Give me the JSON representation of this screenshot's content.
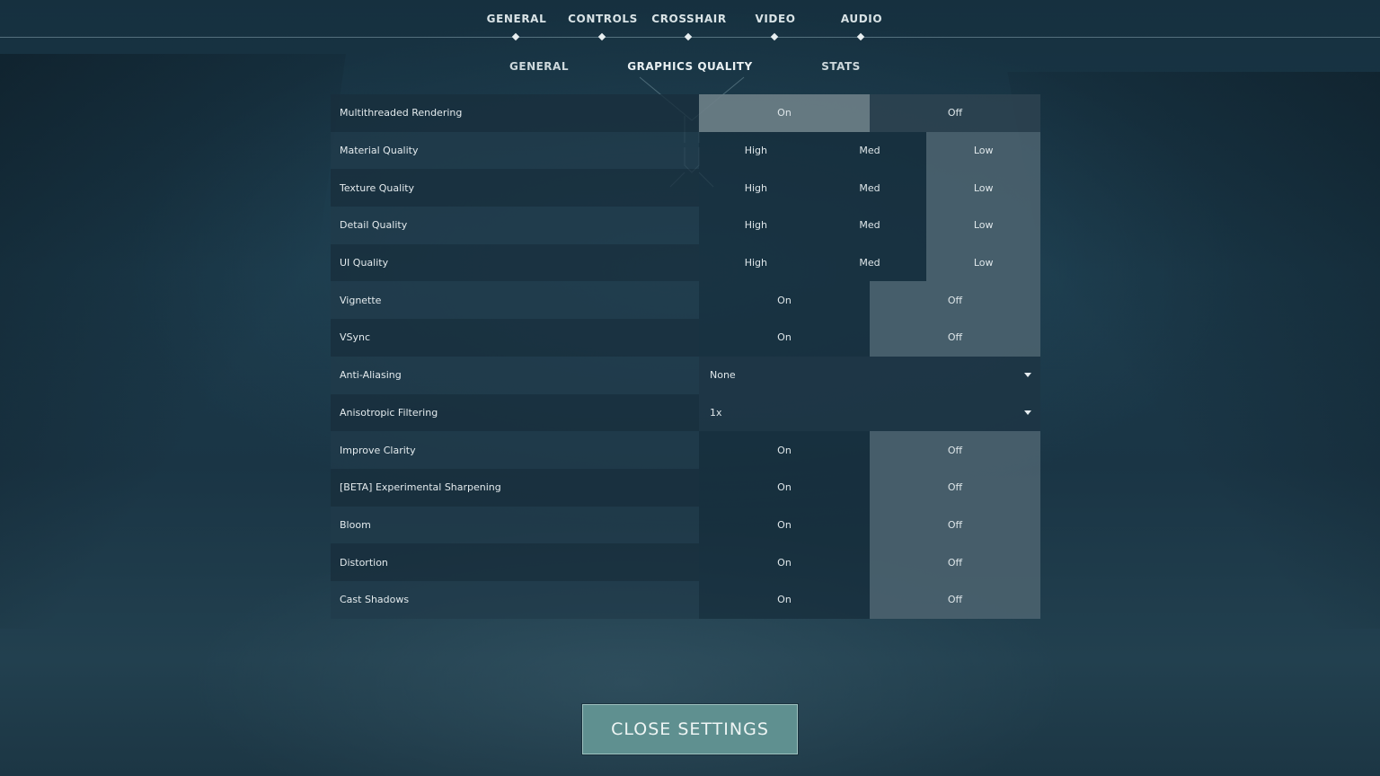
{
  "top_tabs": [
    {
      "label": "GENERAL"
    },
    {
      "label": "CONTROLS"
    },
    {
      "label": "CROSSHAIR"
    },
    {
      "label": "VIDEO"
    },
    {
      "label": "AUDIO"
    }
  ],
  "sub_tabs": [
    {
      "label": "GENERAL"
    },
    {
      "label": "GRAPHICS QUALITY",
      "active": true
    },
    {
      "label": "STATS"
    }
  ],
  "settings": [
    {
      "label": "Multithreaded Rendering",
      "type": "toggle",
      "options": [
        "On",
        "Off"
      ],
      "selected": "On"
    },
    {
      "label": "Material Quality",
      "type": "tri",
      "options": [
        "High",
        "Med",
        "Low"
      ],
      "selected": "Low"
    },
    {
      "label": "Texture Quality",
      "type": "tri",
      "options": [
        "High",
        "Med",
        "Low"
      ],
      "selected": "Low"
    },
    {
      "label": "Detail Quality",
      "type": "tri",
      "options": [
        "High",
        "Med",
        "Low"
      ],
      "selected": "Low"
    },
    {
      "label": "UI Quality",
      "type": "tri",
      "options": [
        "High",
        "Med",
        "Low"
      ],
      "selected": "Low"
    },
    {
      "label": "Vignette",
      "type": "toggle",
      "options": [
        "On",
        "Off"
      ],
      "selected": "Off"
    },
    {
      "label": "VSync",
      "type": "toggle",
      "options": [
        "On",
        "Off"
      ],
      "selected": "Off"
    },
    {
      "label": "Anti-Aliasing",
      "type": "dropdown",
      "value": "None"
    },
    {
      "label": "Anisotropic Filtering",
      "type": "dropdown",
      "value": "1x"
    },
    {
      "label": "Improve Clarity",
      "type": "toggle",
      "options": [
        "On",
        "Off"
      ],
      "selected": "Off"
    },
    {
      "label": "[BETA] Experimental Sharpening",
      "type": "toggle",
      "options": [
        "On",
        "Off"
      ],
      "selected": "Off"
    },
    {
      "label": "Bloom",
      "type": "toggle",
      "options": [
        "On",
        "Off"
      ],
      "selected": "Off"
    },
    {
      "label": "Distortion",
      "type": "toggle",
      "options": [
        "On",
        "Off"
      ],
      "selected": "Off"
    },
    {
      "label": "Cast Shadows",
      "type": "toggle",
      "options": [
        "On",
        "Off"
      ],
      "selected": "Off"
    }
  ],
  "close_button": {
    "label": "CLOSE SETTINGS"
  },
  "icons": {
    "dropdown": "chevron-down-icon",
    "tab_marker": "diamond-icon"
  },
  "colors": {
    "button_bg": "#5f9090",
    "selected_option": "#6e848e",
    "background": "#1b3a4b"
  }
}
